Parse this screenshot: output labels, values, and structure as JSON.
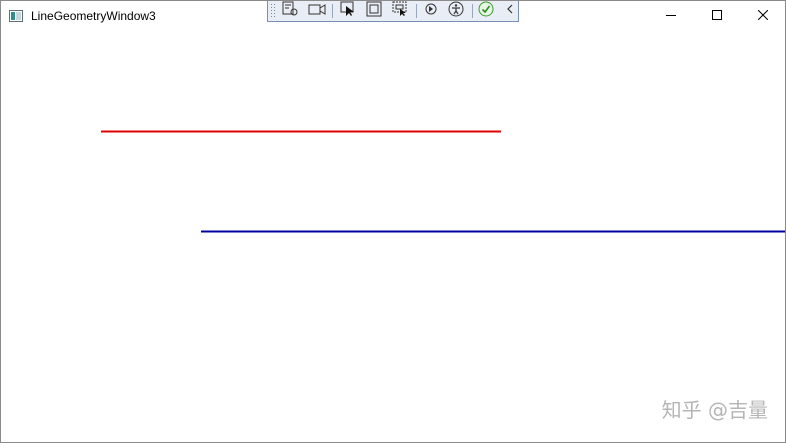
{
  "window": {
    "title": "LineGeometryWindow3"
  },
  "titlebar": {
    "icons": {
      "app": "app-window-icon",
      "minimize": "minimize-icon",
      "maximize": "maximize-icon",
      "close": "close-icon"
    }
  },
  "dev_toolbar": {
    "icons": [
      "live-visual-tree-icon",
      "record-icon",
      "select-element-icon",
      "display-layout-adorners-icon",
      "track-focused-element-icon",
      "hot-reload-icon",
      "accessibility-icon",
      "binding-status-ok-icon",
      "collapse-toolbar-icon"
    ]
  },
  "lines": [
    {
      "name": "red-line",
      "color": "#e00000"
    },
    {
      "name": "blue-line",
      "color": "#0000a0"
    }
  ],
  "watermark": {
    "text": "知乎 @吉量"
  }
}
